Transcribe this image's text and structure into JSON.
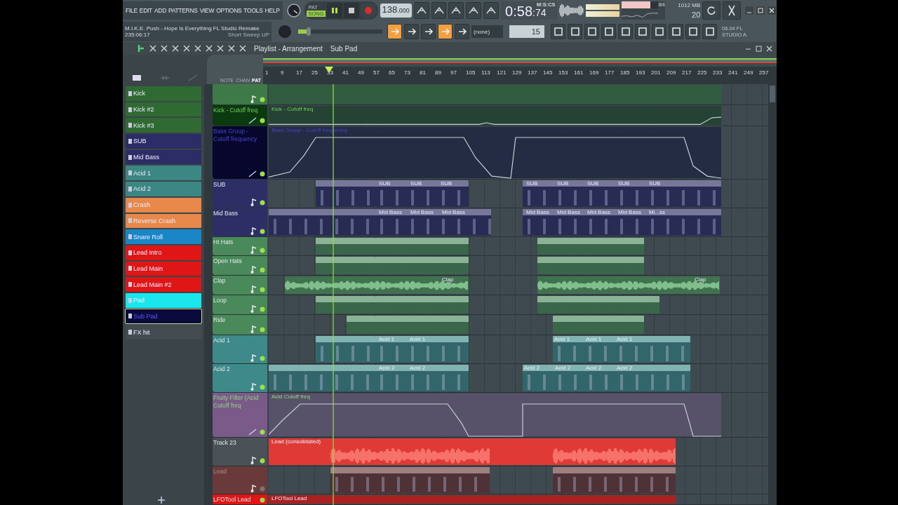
{
  "menu": [
    "FILE",
    "EDIT",
    "ADD",
    "PATTERNS",
    "VIEW",
    "OPTIONS",
    "TOOLS",
    "HELP"
  ],
  "song": {
    "title": "M.I.K.E. Push - Hope Is Everything FL Studio  Remake",
    "position": "235:06:17",
    "hint": "Short Sweep UP"
  },
  "mode": [
    {
      "label": "PAT",
      "selected": false
    },
    {
      "label": "SONG",
      "selected": true
    }
  ],
  "tempo": {
    "whole": "138",
    "fraction": ".000"
  },
  "time": {
    "value": "0:58",
    "centis": ":74",
    "format": "M:S:CS"
  },
  "cpu": {
    "value": "84",
    "level": 0.78
  },
  "memory": {
    "value": "1012 MB",
    "polyphony": "20"
  },
  "master_pitch": {
    "level": 0.1
  },
  "snap": "(none)",
  "pattern_number": "15",
  "news": {
    "line1": "06.04  FL",
    "line2": "STUDIO A"
  },
  "playlist": {
    "title": "Playlist - Arrangement",
    "pattern": "Sub Pad",
    "ruler_modes": [
      {
        "label": "NOTE",
        "selected": false
      },
      {
        "label": "CHAN",
        "selected": false
      },
      {
        "label": "PAT",
        "selected": true
      }
    ],
    "bars": [
      "1",
      "9",
      "17",
      "25",
      "33",
      "41",
      "49",
      "57",
      "65",
      "73",
      "81",
      "89",
      "97",
      "105",
      "113",
      "121",
      "129",
      "137",
      "145",
      "153",
      "161",
      "169",
      "177",
      "185",
      "193",
      "201",
      "209",
      "217",
      "225",
      "233",
      "241",
      "249",
      "257"
    ]
  },
  "patterns": [
    {
      "name": "Kick",
      "color": "#2f6a32",
      "selected": false
    },
    {
      "name": "Kick #2",
      "color": "#2f6a32",
      "selected": false
    },
    {
      "name": "Kick #3",
      "color": "#2f6a32",
      "selected": false
    },
    {
      "name": "SUB",
      "color": "#2c2c66",
      "selected": false
    },
    {
      "name": "Mid Bass",
      "color": "#2c2c66",
      "selected": false
    },
    {
      "name": "Acid 1",
      "color": "#3c8684",
      "selected": false
    },
    {
      "name": "Acid 2",
      "color": "#3c8684",
      "selected": false
    },
    {
      "name": "Crash",
      "color": "#e8884a",
      "selected": false
    },
    {
      "name": "Reverse Crash",
      "color": "#e8884a",
      "selected": false
    },
    {
      "name": "Snare Roll",
      "color": "#1a86c8",
      "selected": false
    },
    {
      "name": "Lead Intro",
      "color": "#e01616",
      "selected": false
    },
    {
      "name": "Lead Main",
      "color": "#e01616",
      "selected": false
    },
    {
      "name": "Lead Main #2",
      "color": "#e01616",
      "selected": false
    },
    {
      "name": "Pad",
      "color": "#1ae6ee",
      "selected": false
    },
    {
      "name": "Sub Pad",
      "color": "#0a0a3c",
      "selected": true
    },
    {
      "name": "FX hit",
      "color": "#454c51",
      "selected": false
    }
  ],
  "tracks": [
    {
      "kind": "pattern",
      "color": "#3e7a48",
      "muted": false
    },
    {
      "kind": "automation",
      "name": "Kick - Cutoff freq",
      "color": "#0c3a10",
      "muted": false,
      "clips": [
        {
          "label": "Kick - Cutoff freq"
        }
      ]
    },
    {
      "kind": "automation",
      "name": "Bass Group - Cutoff frequency",
      "color": "#07072e",
      "muted": false,
      "clips": [
        {
          "label": "Bass Group - Cutoff frequency"
        }
      ]
    },
    {
      "kind": "pattern",
      "name": "SUB",
      "color": "#2e2e66",
      "muted": false,
      "clips": [
        {
          "label": "SUB"
        },
        {
          "label": "SUB"
        },
        {
          "label": "SUB"
        },
        {
          "label": "SUB"
        },
        {
          "label": "SUB"
        },
        {
          "label": "SUB"
        },
        {
          "label": "SUB"
        },
        {
          "label": "SUB"
        }
      ]
    },
    {
      "kind": "pattern",
      "name": "Mid Bass",
      "color": "#2e2e66",
      "muted": false,
      "clips": [
        {
          "label": "Mid Bass"
        },
        {
          "label": "Mid Bass"
        },
        {
          "label": "Mid Bass"
        },
        {
          "label": "Mid Bass"
        },
        {
          "label": "Mid Bass"
        },
        {
          "label": "Mid Bass"
        },
        {
          "label": "Mid Bass"
        },
        {
          "label": "Mi...ss"
        }
      ]
    },
    {
      "kind": "pattern",
      "name": "HI Hats",
      "color": "#4a8a5a",
      "muted": false
    },
    {
      "kind": "pattern",
      "name": "Open Hats",
      "color": "#4a8a5a",
      "muted": false
    },
    {
      "kind": "audio",
      "name": "Clap",
      "color": "#4a8a5a",
      "muted": false,
      "clips": [
        {
          "label": "Clap"
        },
        {
          "label": "Clap"
        }
      ]
    },
    {
      "kind": "pattern",
      "name": "Loop",
      "color": "#4a8a5a",
      "muted": false
    },
    {
      "kind": "pattern",
      "name": "Ride",
      "color": "#4a8a5a",
      "muted": false
    },
    {
      "kind": "pattern",
      "name": "Acid 1",
      "color": "#3e8a8a",
      "muted": false,
      "clips": [
        {
          "label": "Acid 1"
        },
        {
          "label": "Acid 1"
        },
        {
          "label": "Acid 1"
        },
        {
          "label": "Acid 1"
        },
        {
          "label": "Acid 1"
        }
      ]
    },
    {
      "kind": "pattern",
      "name": "Acid 2",
      "color": "#3e8a8a",
      "muted": false,
      "clips": [
        {
          "label": "Acid 2"
        },
        {
          "label": "Acid 2"
        },
        {
          "label": "Acid 2"
        },
        {
          "label": "Acid 2"
        },
        {
          "label": "Acid 2"
        },
        {
          "label": "Acid 2"
        }
      ]
    },
    {
      "kind": "automation",
      "name": "Fruity Filter (Acid Cutoff freq",
      "color": "#7a5a88",
      "muted": false,
      "clips": [
        {
          "label": "Acid  Cutoff freq"
        }
      ]
    },
    {
      "kind": "audio",
      "name": "Track 23",
      "color": "#4a5258",
      "muted": false,
      "clips": [
        {
          "label": "Lead (consolidated)"
        }
      ]
    },
    {
      "kind": "pattern",
      "name": "Lead",
      "color": "#6a3a3a",
      "muted": true
    },
    {
      "kind": "audio",
      "name": "LFOTool Lead",
      "color": "#e01616",
      "muted": false,
      "clips": [
        {
          "label": "LFOTool Lead"
        }
      ]
    }
  ]
}
